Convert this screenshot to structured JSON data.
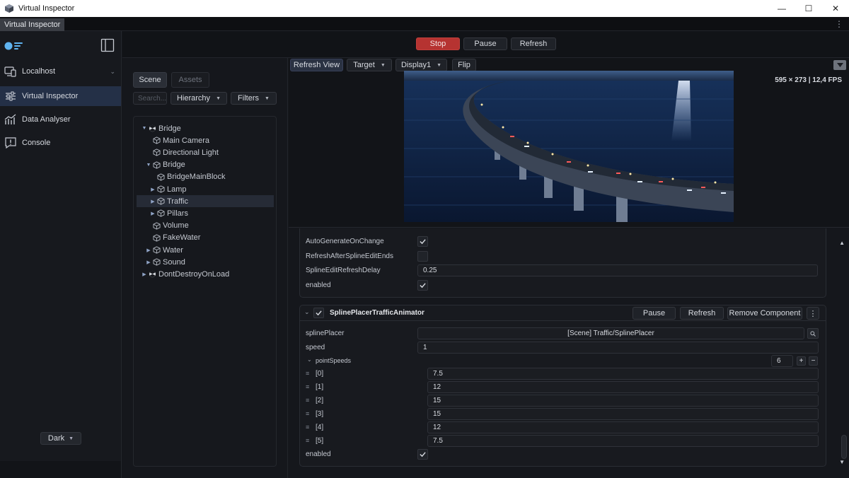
{
  "window": {
    "title": "Virtual Inspector",
    "tab": "Virtual Inspector",
    "minimize": "—",
    "maximize": "☐",
    "close": "✕",
    "kebab": "⋮"
  },
  "sidebar": {
    "items": [
      {
        "label": "Localhost",
        "icon": "devices-icon"
      },
      {
        "label": "Virtual Inspector",
        "icon": "sliders-icon"
      },
      {
        "label": "Data Analyser",
        "icon": "chart-icon"
      },
      {
        "label": "Console",
        "icon": "alert-icon"
      }
    ],
    "theme": "Dark"
  },
  "toolbar": {
    "stop": "Stop",
    "pause": "Pause",
    "refresh": "Refresh"
  },
  "hierarchy": {
    "tabs": [
      "Scene",
      "Assets"
    ],
    "search_placeholder": "Search...",
    "mode": "Hierarchy",
    "filters": "Filters",
    "nodes": [
      {
        "label": "Bridge",
        "depth": 0,
        "arrow": "▼",
        "icon": "scene"
      },
      {
        "label": "Main Camera",
        "depth": 1,
        "arrow": "",
        "icon": "cube"
      },
      {
        "label": "Directional Light",
        "depth": 1,
        "arrow": "",
        "icon": "cube"
      },
      {
        "label": "Bridge",
        "depth": 1,
        "arrow": "▼",
        "icon": "cube"
      },
      {
        "label": "BridgeMainBlock",
        "depth": 2,
        "arrow": "",
        "icon": "cube"
      },
      {
        "label": "Lamp",
        "depth": 2,
        "arrow": "▶",
        "icon": "cube"
      },
      {
        "label": "Traffic",
        "depth": 2,
        "arrow": "▶",
        "icon": "cube",
        "selected": true
      },
      {
        "label": "Pillars",
        "depth": 2,
        "arrow": "▶",
        "icon": "cube"
      },
      {
        "label": "Volume",
        "depth": 1,
        "arrow": "",
        "icon": "cube"
      },
      {
        "label": "FakeWater",
        "depth": 1,
        "arrow": "",
        "icon": "cube"
      },
      {
        "label": "Water",
        "depth": 1,
        "arrow": "▶",
        "icon": "cube"
      },
      {
        "label": "Sound",
        "depth": 1,
        "arrow": "▶",
        "icon": "cube"
      },
      {
        "label": "DontDestroyOnLoad",
        "depth": 0,
        "arrow": "▶",
        "icon": "scene"
      }
    ]
  },
  "view": {
    "refresh_view": "Refresh View",
    "target": "Target",
    "display": "Display1",
    "flip": "Flip",
    "stats": "595 × 273 | 12,4 FPS"
  },
  "inspector": {
    "prev_component": {
      "props": [
        {
          "label": "AutoGenerateOnChange",
          "type": "bool",
          "value": true
        },
        {
          "label": "RefreshAfterSplineEditEnds",
          "type": "bool",
          "value": false
        },
        {
          "label": "SplineEditRefreshDelay",
          "type": "text",
          "value": "0.25"
        },
        {
          "label": "enabled",
          "type": "bool",
          "value": true
        }
      ]
    },
    "component": {
      "name": "SplinePlacerTrafficAnimator",
      "pause": "Pause",
      "refresh": "Refresh",
      "remove": "Remove Component",
      "spline_placer_label": "splinePlacer",
      "spline_placer_value": "[Scene] Traffic/SplinePlacer",
      "speed_label": "speed",
      "speed_value": "1",
      "point_speeds_label": "pointSpeeds",
      "point_speeds_count": "6",
      "point_speeds": [
        {
          "index": "[0]",
          "value": "7.5"
        },
        {
          "index": "[1]",
          "value": "12"
        },
        {
          "index": "[2]",
          "value": "15"
        },
        {
          "index": "[3]",
          "value": "15"
        },
        {
          "index": "[4]",
          "value": "12"
        },
        {
          "index": "[5]",
          "value": "7.5"
        }
      ],
      "enabled_label": "enabled",
      "enabled": true
    }
  }
}
